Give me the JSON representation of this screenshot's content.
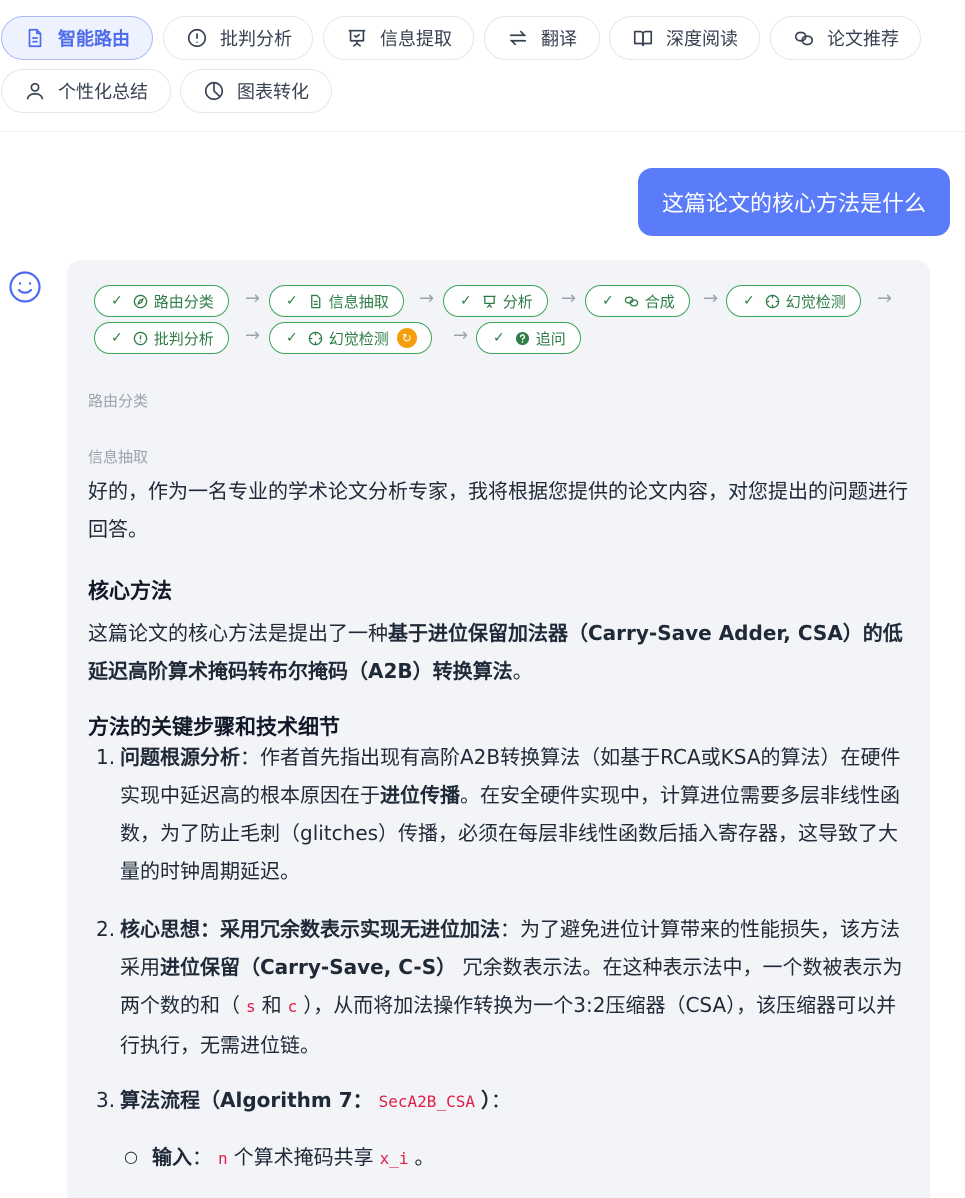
{
  "toolbar": {
    "items": [
      {
        "label": "智能路由",
        "icon": "document-icon"
      },
      {
        "label": "批判分析",
        "icon": "alert-circle-icon"
      },
      {
        "label": "信息提取",
        "icon": "presentation-icon"
      },
      {
        "label": "翻译",
        "icon": "translate-arrows-icon"
      },
      {
        "label": "深度阅读",
        "icon": "open-book-icon"
      },
      {
        "label": "论文推荐",
        "icon": "link-icon"
      },
      {
        "label": "个性化总结",
        "icon": "user-icon"
      },
      {
        "label": "图表转化",
        "icon": "pie-chart-icon"
      }
    ],
    "active_color": "#4f6bed"
  },
  "user_message": "这篇论文的核心方法是什么",
  "pipeline": [
    {
      "label": "路由分类",
      "icon": "compass-icon"
    },
    {
      "label": "信息抽取",
      "icon": "document-icon"
    },
    {
      "label": "分析",
      "icon": "presentation-icon"
    },
    {
      "label": "合成",
      "icon": "link-icon"
    },
    {
      "label": "幻觉检测",
      "icon": "crosshair-icon"
    },
    {
      "label": "批判分析",
      "icon": "alert-circle-icon"
    },
    {
      "label": "幻觉检测",
      "icon": "crosshair-icon",
      "status": "running"
    },
    {
      "label": "追问",
      "icon": "question-icon"
    }
  ],
  "check_mark": "✓",
  "arrow": "→",
  "step_labels": {
    "routing": "路由分类",
    "extraction": "信息抽取"
  },
  "answer": {
    "intro": "好的，作为一名专业的学术论文分析专家，我将根据您提供的论文内容，对您提出的问题进行回答。",
    "h_core": "核心方法",
    "core_pre": "这篇论文的核心方法是提出了一种",
    "core_bold": "基于进位保留加法器（Carry-Save Adder, CSA）的低延迟高阶算术掩码转布尔掩码（A2B）转换算法",
    "core_post": "。",
    "h_steps": "方法的关键步骤和技术细节",
    "steps": [
      {
        "num": "1.",
        "title": "问题根源分析",
        "pre": "：作者首先指出现有高阶A2B转换算法（如基于RCA或KSA的算法）在硬件实现中延迟高的根本原因在于",
        "bold2": "进位传播",
        "post": "。在安全硬件实现中，计算进位需要多层非线性函数，为了防止毛刺（glitches）传播，必须在每层非线性函数后插入寄存器，这导致了大量的时钟周期延迟。"
      },
      {
        "num": "2.",
        "title": "核心思想：采用冗余数表示实现无进位加法",
        "pre": "：为了避免进位计算带来的性能损失，该方法采用",
        "bold2": "进位保留（Carry-Save, C-S）",
        "mid": "冗余数表示法。在这种表示法中，一个数被表示为两个数的和（",
        "code1": "s",
        "and": "和",
        "code2": "c",
        "post": "），从而将加法操作转换为一个3:2压缩器（CSA），该压缩器可以并行执行，无需进位链。"
      },
      {
        "num": "3.",
        "title": "算法流程（Algorithm 7：",
        "code": "SecA2B_CSA",
        "title_end": "）",
        "post": "："
      }
    ],
    "sub_bullet": {
      "marker": "○",
      "title": "输入",
      "pre": "：",
      "code1": "n",
      "mid": "个算术掩码共享",
      "code2": "x_i",
      "post": "。"
    }
  }
}
